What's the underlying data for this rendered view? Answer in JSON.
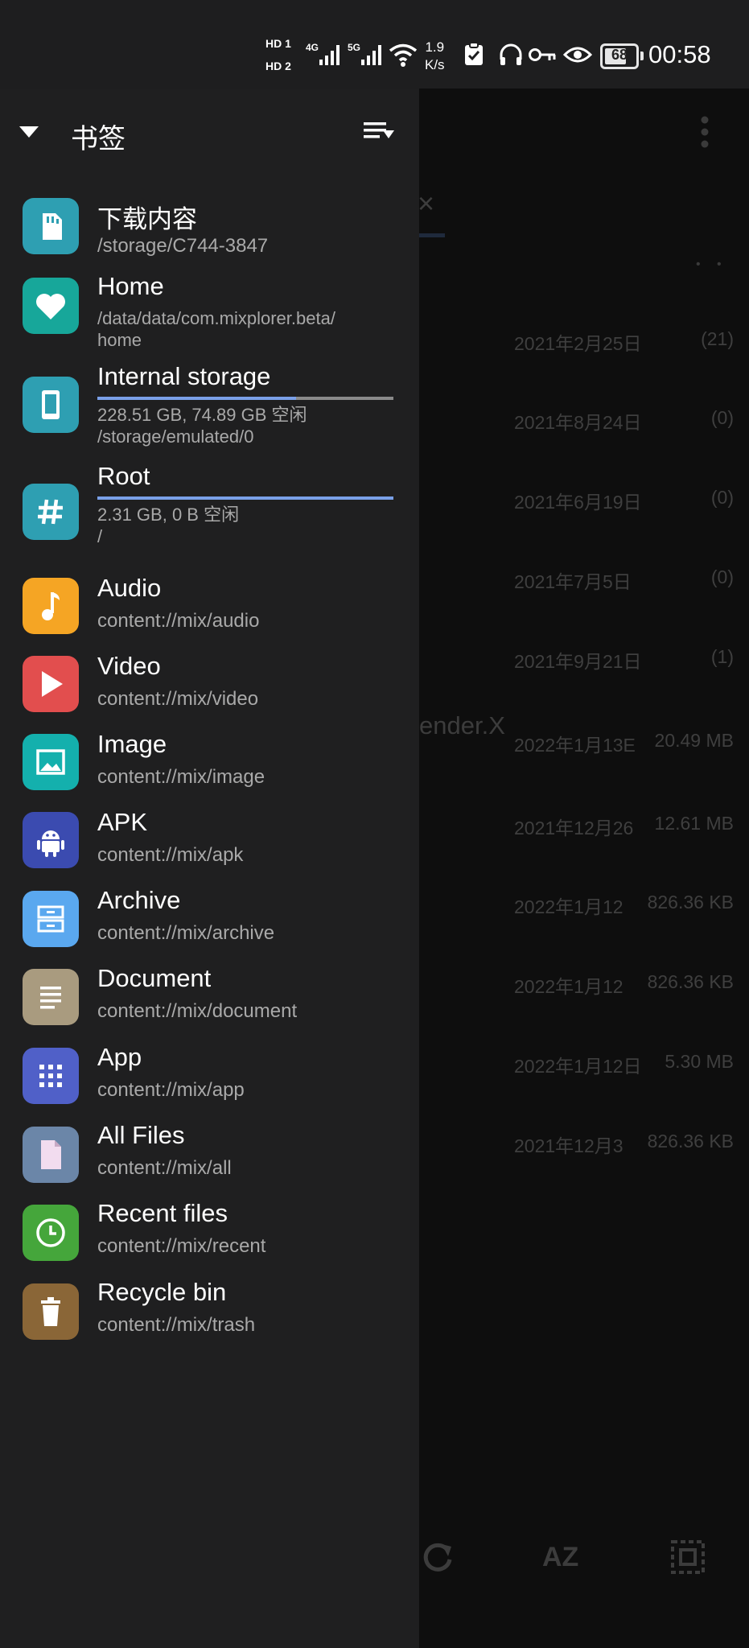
{
  "status_bar": {
    "speed_value": "1.9",
    "speed_unit": "K/s",
    "battery": "68",
    "time": "00:58",
    "hd1": "HD 1",
    "hd2": "HD 2",
    "net1": "4G",
    "net2": "5G"
  },
  "drawer": {
    "title": "书签",
    "bookmarks": [
      {
        "title": "下载内容",
        "sub": "/storage/C744-3847",
        "icon": "sd-card-icon",
        "color": "#2e9fb2"
      },
      {
        "title": "Home",
        "sub": "/data/data/com.mixplorer.beta/",
        "sub2": "home",
        "icon": "heart-icon",
        "color": "#17a79a"
      },
      {
        "title": "Internal storage",
        "sub": "228.51 GB, 74.89 GB 空闲",
        "sub2": "/storage/emulated/0",
        "icon": "phone-icon",
        "color": "#2e9fb2",
        "usage": 0.67
      },
      {
        "title": "Root",
        "sub": "2.31 GB, 0 B 空闲",
        "sub2": "/",
        "icon": "hash-icon",
        "color": "#2e9fb2",
        "usage": 1.0
      },
      {
        "title": "Audio",
        "sub": "content://mix/audio",
        "icon": "music-note-icon",
        "color": "#f5a524"
      },
      {
        "title": "Video",
        "sub": "content://mix/video",
        "icon": "play-icon",
        "color": "#e24e4e"
      },
      {
        "title": "Image",
        "sub": "content://mix/image",
        "icon": "image-icon",
        "color": "#14b0ad"
      },
      {
        "title": "APK",
        "sub": "content://mix/apk",
        "icon": "android-icon",
        "color": "#3b4bb0"
      },
      {
        "title": "Archive",
        "sub": "content://mix/archive",
        "icon": "archive-icon",
        "color": "#5aa8ef"
      },
      {
        "title": "Document",
        "sub": "content://mix/document",
        "icon": "document-icon",
        "color": "#a99b7f"
      },
      {
        "title": "App",
        "sub": "content://mix/app",
        "icon": "grid-icon",
        "color": "#5060c8"
      },
      {
        "title": "All Files",
        "sub": "content://mix/all",
        "icon": "file-icon",
        "color": "#6b86a8"
      },
      {
        "title": "Recent files",
        "sub": "content://mix/recent",
        "icon": "clock-icon",
        "color": "#45a63b"
      },
      {
        "title": "Recycle bin",
        "sub": "content://mix/trash",
        "icon": "trash-icon",
        "color": "#8a6637"
      }
    ]
  },
  "background": {
    "close_glyph": "×",
    "dots": "• •",
    "rows": [
      {
        "date": "2021年2月25日",
        "size": "(21)"
      },
      {
        "date": "2021年8月24日",
        "size": "(0)"
      },
      {
        "date": "2021年6月19日",
        "size": "(0)"
      },
      {
        "date": "2021年7月5日",
        "size": "(0)"
      },
      {
        "date": "2021年9月21日",
        "size": "(1)"
      },
      {
        "date": "2022年1月13E",
        "size": "20.49 MB"
      },
      {
        "date": "2021年12月26",
        "size": "12.61 MB"
      },
      {
        "date": "2022年1月12",
        "size": "826.36  KB"
      },
      {
        "date": "2022年1月12",
        "size": "826.36  KB"
      },
      {
        "date": "2022年1月12日",
        "size": "5.30 MB"
      },
      {
        "date": "2021年12月3",
        "size": "826.36  KB"
      }
    ],
    "name_fragment": "ender.X",
    "az_label": "AZ"
  }
}
